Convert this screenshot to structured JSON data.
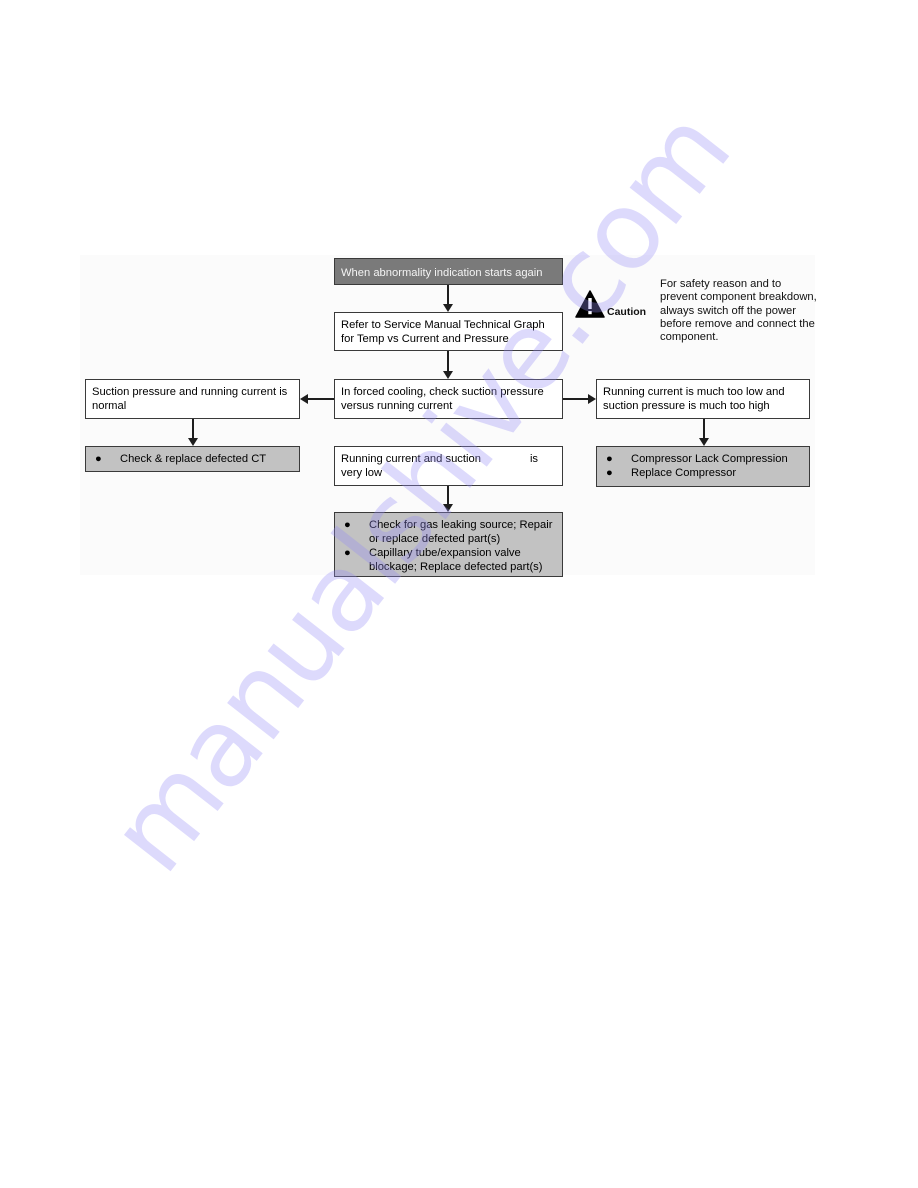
{
  "flowchart": {
    "start": "When abnormality indication starts again",
    "step_refer": "Refer to Service Manual Technical Graph for Temp vs Current and Pressure",
    "step_check": "In forced cooling, check suction pressure versus running current",
    "branch_left": {
      "condition": "Suction pressure and running current is normal",
      "actions": [
        "Check & replace defected CT"
      ]
    },
    "branch_center": {
      "condition_part1": "Running current and suction",
      "condition_gap_word": "is",
      "condition_part2": "very low",
      "actions": [
        "Check for gas leaking source; Repair or replace defected part(s)",
        "Capillary tube/expansion valve blockage; Replace defected part(s)"
      ]
    },
    "branch_right": {
      "condition": "Running current is much too low and suction pressure is much too high",
      "actions": [
        "Compressor Lack Compression",
        "Replace Compressor"
      ]
    }
  },
  "caution": {
    "icon": "warning-triangle-icon",
    "label": "Caution",
    "text": "For safety reason and to prevent component breakdown, always switch off the power before remove and connect the component."
  },
  "bullet_glyph": "●",
  "watermark": "manualshive.com"
}
